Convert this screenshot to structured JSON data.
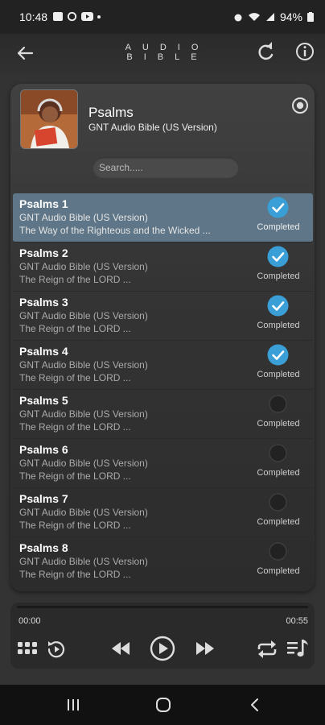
{
  "status_bar": {
    "time": "10:48",
    "battery": "94%",
    "icons": [
      "gallery-icon",
      "sync-icon",
      "youtube-icon",
      "dot-icon",
      "alarm-icon",
      "wifi-icon",
      "signal-icon",
      "battery-icon"
    ]
  },
  "header": {
    "title": "AUDIO BIBLE",
    "icons": [
      "back-arrow-icon",
      "refresh-icon",
      "info-icon"
    ]
  },
  "book": {
    "name": "Psalms",
    "version": "GNT Audio Bible (US Version)"
  },
  "search": {
    "placeholder": "Search....."
  },
  "chapters": [
    {
      "title": "Psalms 1",
      "version": "GNT Audio Bible (US Version)",
      "description": "The Way of the Righteous and the Wicked ...",
      "status": "Completed",
      "done": true,
      "selected": true
    },
    {
      "title": "Psalms 2",
      "version": "GNT Audio Bible (US Version)",
      "description": "The Reign of the LORD ...",
      "status": "Completed",
      "done": true,
      "selected": false
    },
    {
      "title": "Psalms 3",
      "version": "GNT Audio Bible (US Version)",
      "description": "The Reign of the LORD ...",
      "status": "Completed",
      "done": true,
      "selected": false
    },
    {
      "title": "Psalms 4",
      "version": "GNT Audio Bible (US Version)",
      "description": "The Reign of the LORD ...",
      "status": "Completed",
      "done": true,
      "selected": false
    },
    {
      "title": "Psalms 5",
      "version": "GNT Audio Bible (US Version)",
      "description": "The Reign of the LORD ...",
      "status": "Completed",
      "done": false,
      "selected": false
    },
    {
      "title": "Psalms 6",
      "version": "GNT Audio Bible (US Version)",
      "description": "The Reign of the LORD ...",
      "status": "Completed",
      "done": false,
      "selected": false
    },
    {
      "title": "Psalms 7",
      "version": "GNT Audio Bible (US Version)",
      "description": "The Reign of the LORD ...",
      "status": "Completed",
      "done": false,
      "selected": false
    },
    {
      "title": "Psalms 8",
      "version": "GNT Audio Bible (US Version)",
      "description": "The Reign of the LORD ...",
      "status": "Completed",
      "done": false,
      "selected": false
    }
  ],
  "player": {
    "current_time": "00:00",
    "total_time": "00:55",
    "progress": 0
  },
  "colors": {
    "accent": "#3a9fd6",
    "selected_row": "#5e7687",
    "background": "#333333"
  }
}
